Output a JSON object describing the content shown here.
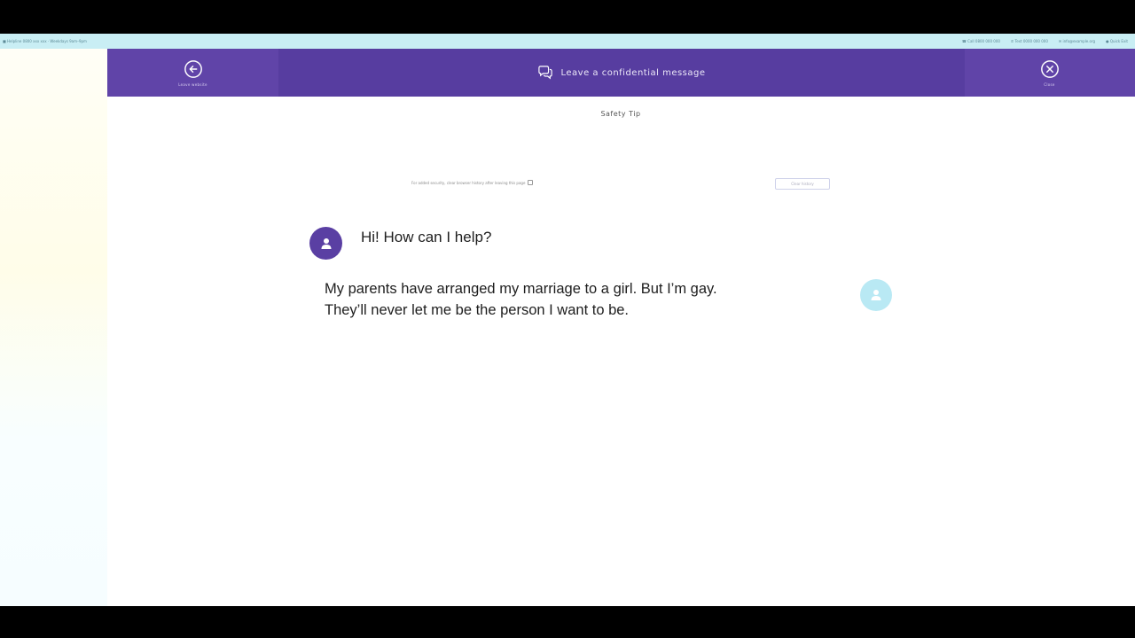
{
  "info_strip": {
    "left_text": "■ Helpline 0800 xxx xxx · Weekdays 9am–9pm",
    "right_items": [
      "☎ Call 0800 000 000",
      "✆ Text 0000 000 000",
      "✉ info@example.org",
      "● Quick Exit"
    ]
  },
  "header": {
    "back_label": "Leave website",
    "title": "Leave a confidential message",
    "close_label": "Close",
    "colors": {
      "bar": "#6044a8",
      "center": "#573da0"
    }
  },
  "safety_tip": "Safety Tip",
  "notice": {
    "text": "For added security, clear browser history after leaving this page",
    "button_label": "Clear history"
  },
  "conversation": {
    "bot_message": "Hi! How can I help?",
    "user_message_lines": [
      "My parents have arranged my marriage to a girl. But I’m gay.",
      "They’ll never let me be the person I want to be."
    ]
  },
  "icons": {
    "back": "back-arrow-icon",
    "chat": "chat-bubbles-icon",
    "close": "close-circle-icon",
    "bot_avatar": "user-icon",
    "user_avatar": "user-icon"
  }
}
